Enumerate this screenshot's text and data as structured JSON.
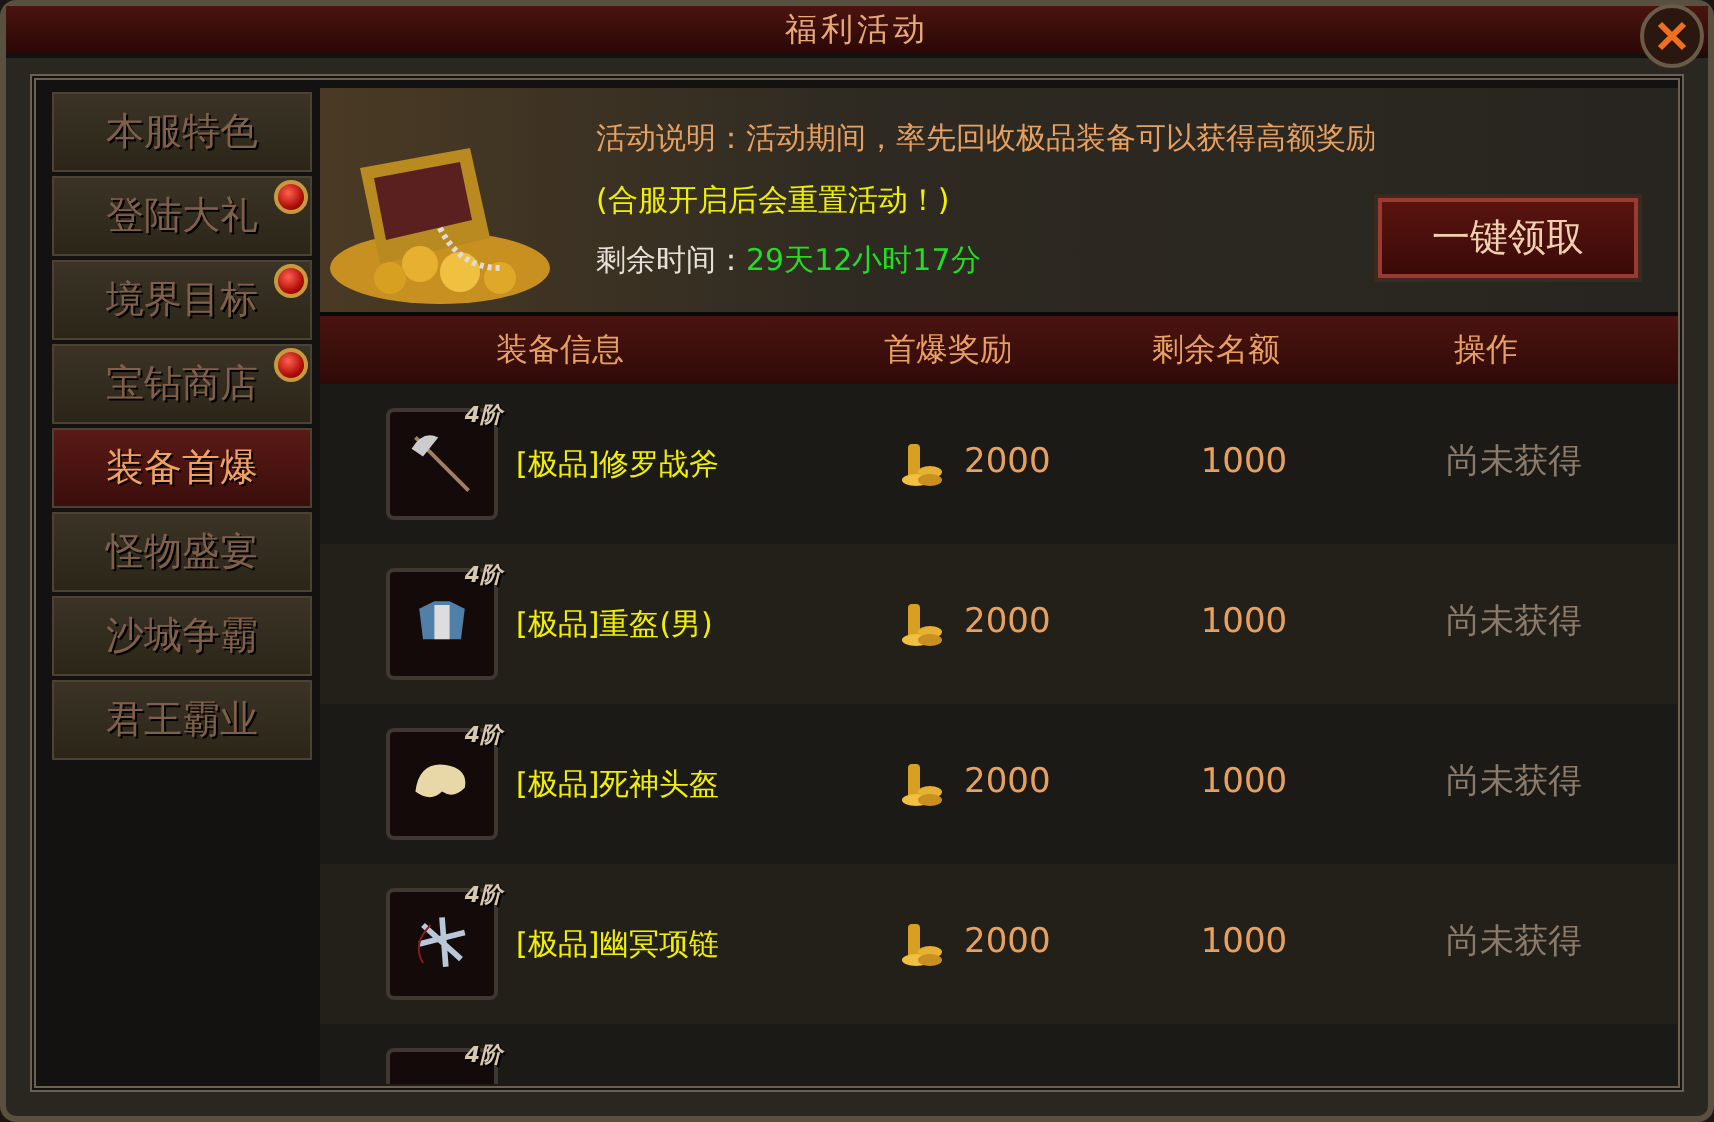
{
  "window": {
    "title": "福利活动"
  },
  "sidebar": {
    "items": [
      {
        "label": "本服特色",
        "selected": false,
        "badge": false
      },
      {
        "label": "登陆大礼",
        "selected": false,
        "badge": true
      },
      {
        "label": "境界目标",
        "selected": false,
        "badge": true
      },
      {
        "label": "宝钻商店",
        "selected": false,
        "badge": true
      },
      {
        "label": "装备首爆",
        "selected": true,
        "badge": false
      },
      {
        "label": "怪物盛宴",
        "selected": false,
        "badge": false
      },
      {
        "label": "沙城争霸",
        "selected": false,
        "badge": false
      },
      {
        "label": "君王霸业",
        "selected": false,
        "badge": false
      }
    ]
  },
  "banner": {
    "description": "活动说明：活动期间，率先回收极品装备可以获得高额奖励",
    "notice": "(合服开启后会重置活动！)",
    "time_label": "剩余时间：",
    "time_value": "29天12小时17分",
    "claim_button": "一键领取"
  },
  "table": {
    "columns": [
      "装备信息",
      "首爆奖励",
      "剩余名额",
      "操作"
    ],
    "rows": [
      {
        "kind": "axe",
        "grade": "4阶",
        "name": "[极品]修罗战斧",
        "reward": "2000",
        "remaining": "1000",
        "status": "尚未获得"
      },
      {
        "kind": "armor",
        "grade": "4阶",
        "name": "[极品]重盔(男)",
        "reward": "2000",
        "remaining": "1000",
        "status": "尚未获得"
      },
      {
        "kind": "helmet",
        "grade": "4阶",
        "name": "[极品]死神头盔",
        "reward": "2000",
        "remaining": "1000",
        "status": "尚未获得"
      },
      {
        "kind": "necklace",
        "grade": "4阶",
        "name": "[极品]幽冥项链",
        "reward": "2000",
        "remaining": "1000",
        "status": "尚未获得"
      }
    ],
    "partial_row": {
      "grade": "4阶"
    }
  }
}
